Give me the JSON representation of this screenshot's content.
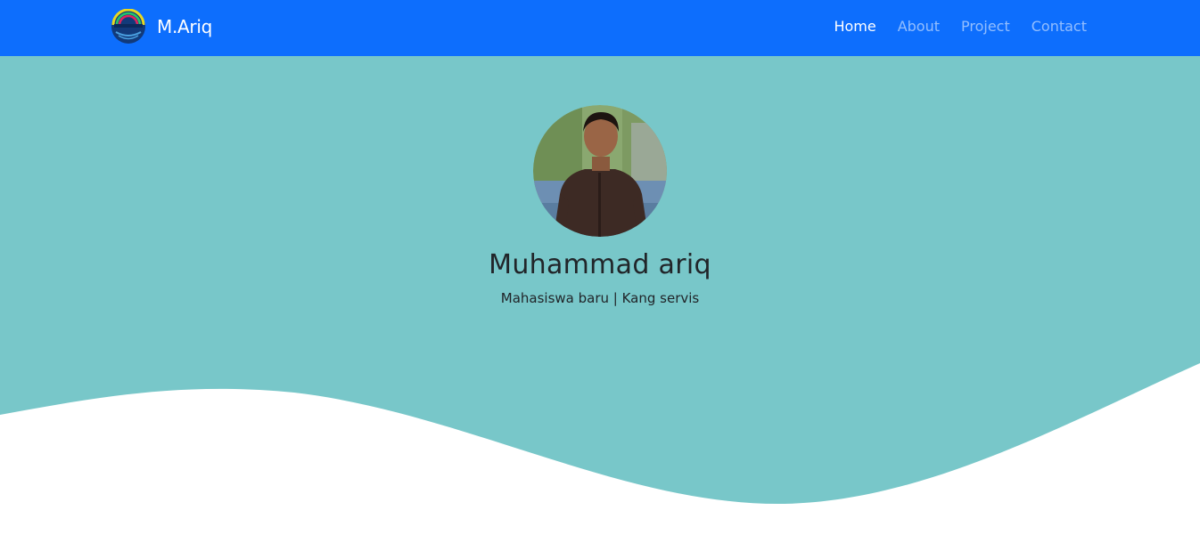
{
  "navbar": {
    "brand": "M.Ariq",
    "links": [
      {
        "label": "Home",
        "active": true
      },
      {
        "label": "About",
        "active": false
      },
      {
        "label": "Project",
        "active": false
      },
      {
        "label": "Contact",
        "active": false
      }
    ]
  },
  "hero": {
    "name": "Muhammad ariq",
    "tagline": "Mahasiswa baru | Kang servis"
  },
  "colors": {
    "navbar_bg": "#0d6efd",
    "hero_bg": "#78c7c9",
    "text": "#212529"
  }
}
